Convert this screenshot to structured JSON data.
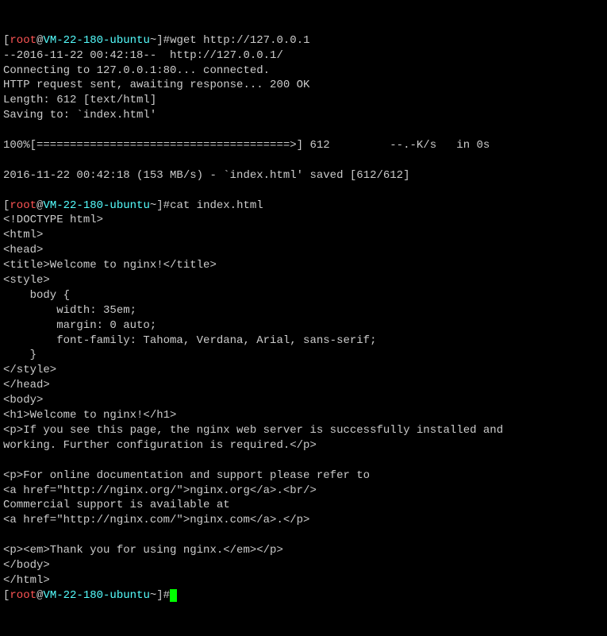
{
  "prompt": {
    "openBracket": "[",
    "user": "root",
    "at": "@",
    "host": "VM-22-180-ubuntu",
    "tilde": "~",
    "closeBracket": "]",
    "hash": "#"
  },
  "cmd1": "wget http://127.0.0.1",
  "wget": {
    "l1": "--2016-11-22 00:42:18--  http://127.0.0.1/",
    "l2": "Connecting to 127.0.0.1:80... connected.",
    "l3": "HTTP request sent, awaiting response... 200 OK",
    "l4": "Length: 612 [text/html]",
    "l5": "Saving to: `index.html'",
    "l6": "",
    "l7": "100%[======================================>] 612         --.-K/s   in 0s",
    "l8": "",
    "l9": "2016-11-22 00:42:18 (153 MB/s) - `index.html' saved [612/612]",
    "l10": ""
  },
  "cmd2": "cat index.html",
  "cat": {
    "l1": "<!DOCTYPE html>",
    "l2": "<html>",
    "l3": "<head>",
    "l4": "<title>Welcome to nginx!</title>",
    "l5": "<style>",
    "l6": "    body {",
    "l7": "        width: 35em;",
    "l8": "        margin: 0 auto;",
    "l9": "        font-family: Tahoma, Verdana, Arial, sans-serif;",
    "l10": "    }",
    "l11": "</style>",
    "l12": "</head>",
    "l13": "<body>",
    "l14": "<h1>Welcome to nginx!</h1>",
    "l15": "<p>If you see this page, the nginx web server is successfully installed and",
    "l16": "working. Further configuration is required.</p>",
    "l17": "",
    "l18": "<p>For online documentation and support please refer to",
    "l19": "<a href=\"http://nginx.org/\">nginx.org</a>.<br/>",
    "l20": "Commercial support is available at",
    "l21": "<a href=\"http://nginx.com/\">nginx.com</a>.</p>",
    "l22": "",
    "l23": "<p><em>Thank you for using nginx.</em></p>",
    "l24": "</body>",
    "l25": "</html>"
  }
}
